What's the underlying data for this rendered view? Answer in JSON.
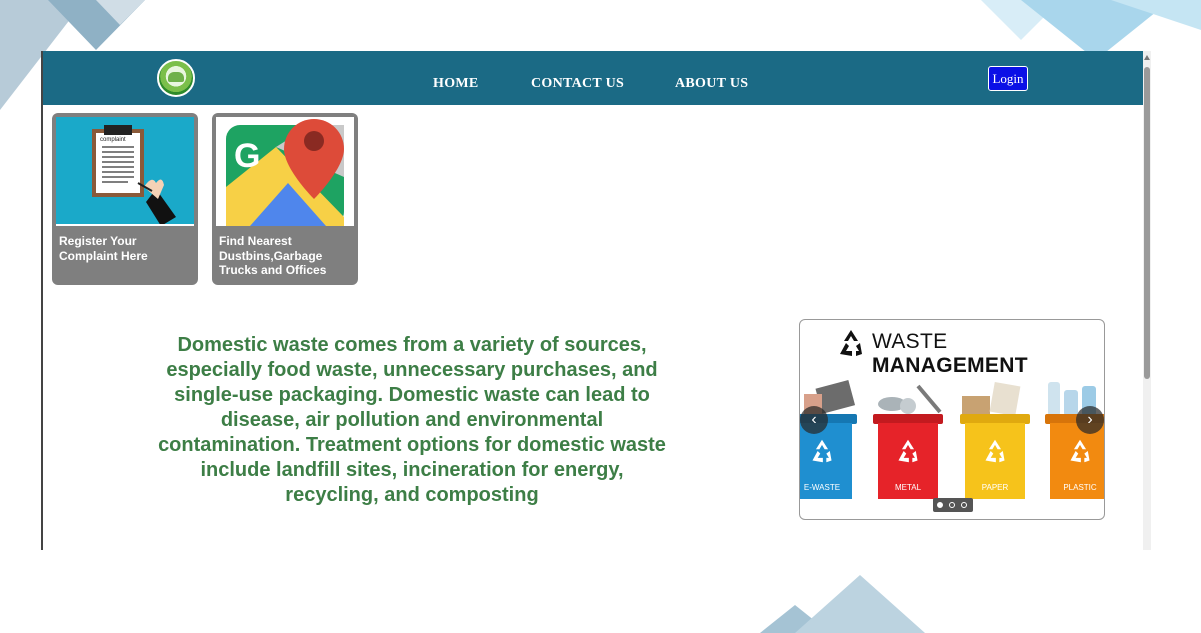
{
  "nav": {
    "links": [
      "HOME",
      "CONTACT US",
      "ABOUT US"
    ],
    "login_label": "Login"
  },
  "cards": [
    {
      "label": "Register Your Complaint Here",
      "image_text": "complaint"
    },
    {
      "label": "Find Nearest Dustbins,Garbage Trucks and Offices"
    }
  ],
  "info_text": "Domestic waste comes from a variety of sources, especially food waste, unnecessary purchases, and single-use packaging. Domestic waste can lead to disease, air pollution and environmental contamination. Treatment options for domestic waste include landfill sites, incineration for energy, recycling, and composting",
  "carousel": {
    "title_light": "WASTE ",
    "title_bold": "MANAGEMENT",
    "bins": [
      {
        "label": "E-WASTE",
        "color": "#1f8fd0"
      },
      {
        "label": "METAL",
        "color": "#e62329"
      },
      {
        "label": "PAPER",
        "color": "#f6c31b"
      },
      {
        "label": "PLASTIC",
        "color": "#f28a10"
      }
    ],
    "prev_icon": "‹",
    "next_icon": "›",
    "active_slide": 1,
    "slide_count": 3
  },
  "colors": {
    "navbar": "#1b6a85",
    "text_green": "#3d7e46",
    "card_bg": "#7f7f7f",
    "login_bg": "#0b10e6"
  }
}
